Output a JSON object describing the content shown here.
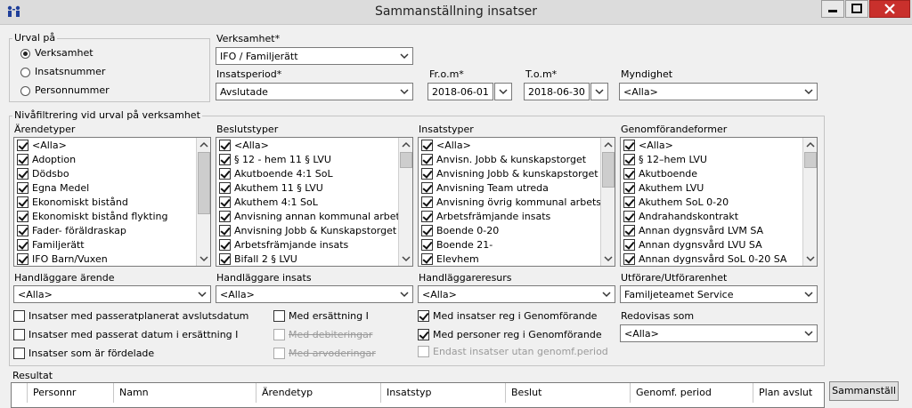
{
  "window": {
    "title": "Sammanställning insatser"
  },
  "urval": {
    "label": "Urval på",
    "options": [
      {
        "label": "Verksamhet",
        "selected": true
      },
      {
        "label": "Insatsnummer",
        "selected": false
      },
      {
        "label": "Personnummer",
        "selected": false
      }
    ]
  },
  "fields": {
    "verksamhet": {
      "label": "Verksamhet*",
      "value": "IFO / Familjerätt"
    },
    "insatsperiod": {
      "label": "Insatsperiod*",
      "value": "Avslutade"
    },
    "from": {
      "label": "Fr.o.m*",
      "value": "2018-06-01"
    },
    "tom": {
      "label": "T.o.m*",
      "value": "2018-06-30"
    },
    "myndighet": {
      "label": "Myndighet",
      "value": "<Alla>"
    }
  },
  "nivafiltrering": {
    "label": "Nivåfiltrering vid urval på verksamhet"
  },
  "lists": {
    "arendetyper": {
      "label": "Ärendetyper",
      "items": [
        "<Alla>",
        "Adoption",
        "Dödsbo",
        "Egna Medel",
        "Ekonomiskt bistånd",
        "Ekonomiskt bistånd flykting",
        "Fader- föräldraskap",
        "Familjerätt",
        "IFO Barn/Vuxen"
      ]
    },
    "beslutstyper": {
      "label": "Beslutstyper",
      "items": [
        "<Alla>",
        "§ 12 - hem  11 § LVU",
        "Akutboende 4:1 SoL",
        "Akuthem 11 § LVU",
        "Akuthem 4:1 SoL",
        "Anvisning annan kommunal arbetsmarkn",
        "Anvisning Jobb & Kunskapstorget",
        "Arbetsfrämjande insats",
        "Bifall 2 § LVU"
      ]
    },
    "insatstyper": {
      "label": "Insatstyper",
      "items": [
        "<Alla>",
        "Anvisn. Jobb & kunskapstorget",
        "Anvisning Jobb & kunskapstorget",
        "Anvisning Team utreda",
        "Anvisning övrig kommunal arbetsmarkn",
        "Arbetsfrämjande  insats",
        "Boende 0-20",
        "Boende 21-",
        "Elevhem"
      ]
    },
    "genomforandeformer": {
      "label": "Genomförandeformer",
      "items": [
        "<Alla>",
        "§ 12–hem LVU",
        "Akutboende",
        "Akuthem LVU",
        "Akuthem SoL 0-20",
        "Andrahandskontrakt",
        "Annan dygnsvård LVM SA",
        "Annan dygnsvård LVU SA",
        "Annan dygnsvård SoL 0-20 SA"
      ]
    }
  },
  "handlaggare": {
    "arende": {
      "label": "Handläggare ärende",
      "value": "<Alla>"
    },
    "insats": {
      "label": "Handläggare insats",
      "value": "<Alla>"
    },
    "resurs": {
      "label": "Handläggareresurs",
      "value": "<Alla>"
    },
    "utforare": {
      "label": "Utförare/Utförarenhet",
      "value": "Familjeteamet Service"
    }
  },
  "options": {
    "passerat_planerat": {
      "label": "Insatser med passeratplanerat avslutsdatum",
      "checked": false
    },
    "passerat_ersattning": {
      "label": "Insatser med passerat datum i ersättning I",
      "checked": false
    },
    "fordelade": {
      "label": "Insatser som är fördelade",
      "checked": false
    },
    "med_ersattning": {
      "label": "Med ersättning I",
      "checked": false
    },
    "med_debiteringar": {
      "label": "Med debiteringar",
      "checked": false
    },
    "med_arvoderingar": {
      "label": "Med arvoderingar",
      "checked": false
    },
    "reg_genomforande": {
      "label": "Med insatser reg i Genomförande",
      "checked": true
    },
    "personer_genomforande": {
      "label": "Med personer reg i Genomförande",
      "checked": true
    },
    "utan_genomf": {
      "label": "Endast insatser utan genomf.period",
      "checked": false
    }
  },
  "redovisas": {
    "label": "Redovisas som",
    "value": "<Alla>"
  },
  "resultat": {
    "label": "Resultat",
    "columns": [
      "Personnr",
      "Namn",
      "Ärendetyp",
      "Insatstyp",
      "Beslut",
      "Genomf. period",
      "Plan avslut"
    ]
  },
  "buttons": {
    "sammanstall": "Sammanställ"
  }
}
